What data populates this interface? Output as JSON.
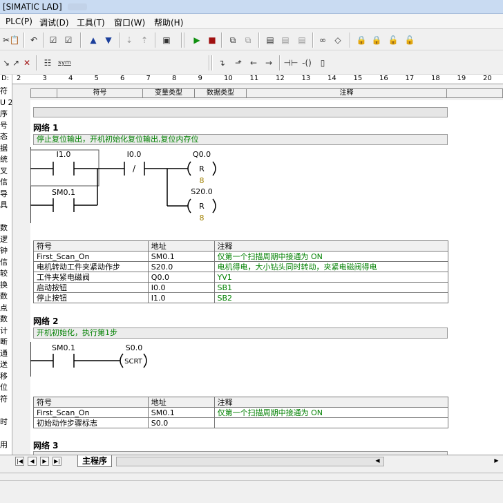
{
  "window": {
    "title": "[SIMATIC LAD]"
  },
  "menu": [
    "PLC(P)",
    "调试(D)",
    "工具(T)",
    "窗口(W)",
    "帮助(H)"
  ],
  "ruler": {
    "label": "D:",
    "ticks": [
      "2",
      "3",
      "4",
      "5",
      "6",
      "7",
      "8",
      "9",
      "10",
      "11",
      "12",
      "13",
      "14",
      "15",
      "16",
      "17",
      "18",
      "19",
      "20"
    ]
  },
  "var_table_headers": {
    "symbol": "符号",
    "var_type": "变量类型",
    "data_type": "数据类型",
    "comment": "注释"
  },
  "left_tree_fragments": [
    "符",
    "U 2",
    "序",
    "号",
    "态",
    "据",
    "统",
    "叉",
    "信",
    "导",
    "具",
    "",
    "数",
    "逻",
    "钟",
    "信",
    "较",
    "换",
    "数",
    "点",
    "数",
    "计",
    "断",
    "通",
    "送",
    "移",
    "位",
    "符",
    "",
    "时",
    "",
    "用"
  ],
  "networks": [
    {
      "title": "网络 1",
      "comment": "停止复位输出，开机初始化复位输出,复位内存位",
      "ladder": {
        "contacts": [
          {
            "addr": "I1.0",
            "type": "no"
          },
          {
            "addr": "SM0.1",
            "type": "no"
          },
          {
            "addr": "I0.0",
            "type": "nc",
            "glyph": "/"
          }
        ],
        "coils": [
          {
            "addr": "Q0.0",
            "op": "R",
            "n": "8"
          },
          {
            "addr": "S20.0",
            "op": "R",
            "n": "8"
          }
        ]
      },
      "table": {
        "headers": [
          "符号",
          "地址",
          "注释"
        ],
        "rows": [
          [
            "First_Scan_On",
            "SM0.1",
            "仅第一个扫描周期中接通为 ON"
          ],
          [
            "电机转动工件夹紧动作步",
            "S20.0",
            "电机得电，大小钻头同时转动，夹紧电磁阀得电"
          ],
          [
            "工件夹紧电磁阀",
            "Q0.0",
            "YV1"
          ],
          [
            "启动按钮",
            "I0.0",
            "SB1"
          ],
          [
            "停止按钮",
            "I1.0",
            "SB2"
          ]
        ]
      }
    },
    {
      "title": "网络 2",
      "comment": "开机初始化，执行第1步",
      "ladder": {
        "contacts": [
          {
            "addr": "SM0.1",
            "type": "no"
          }
        ],
        "coils": [
          {
            "addr": "S0.0",
            "op": "SCRT"
          }
        ]
      },
      "table": {
        "headers": [
          "符号",
          "地址",
          "注释"
        ],
        "rows": [
          [
            "First_Scan_On",
            "SM0.1",
            "仅第一个扫描周期中接通为 ON"
          ],
          [
            "初始动作步骤标志",
            "S0.0",
            ""
          ]
        ]
      }
    },
    {
      "title": "网络 3"
    }
  ],
  "bottom_tab": {
    "label": "主程序"
  },
  "colors": {
    "comment_text": "#008000",
    "coil_count": "#a08000",
    "title_bar": "#c9dbf2"
  }
}
